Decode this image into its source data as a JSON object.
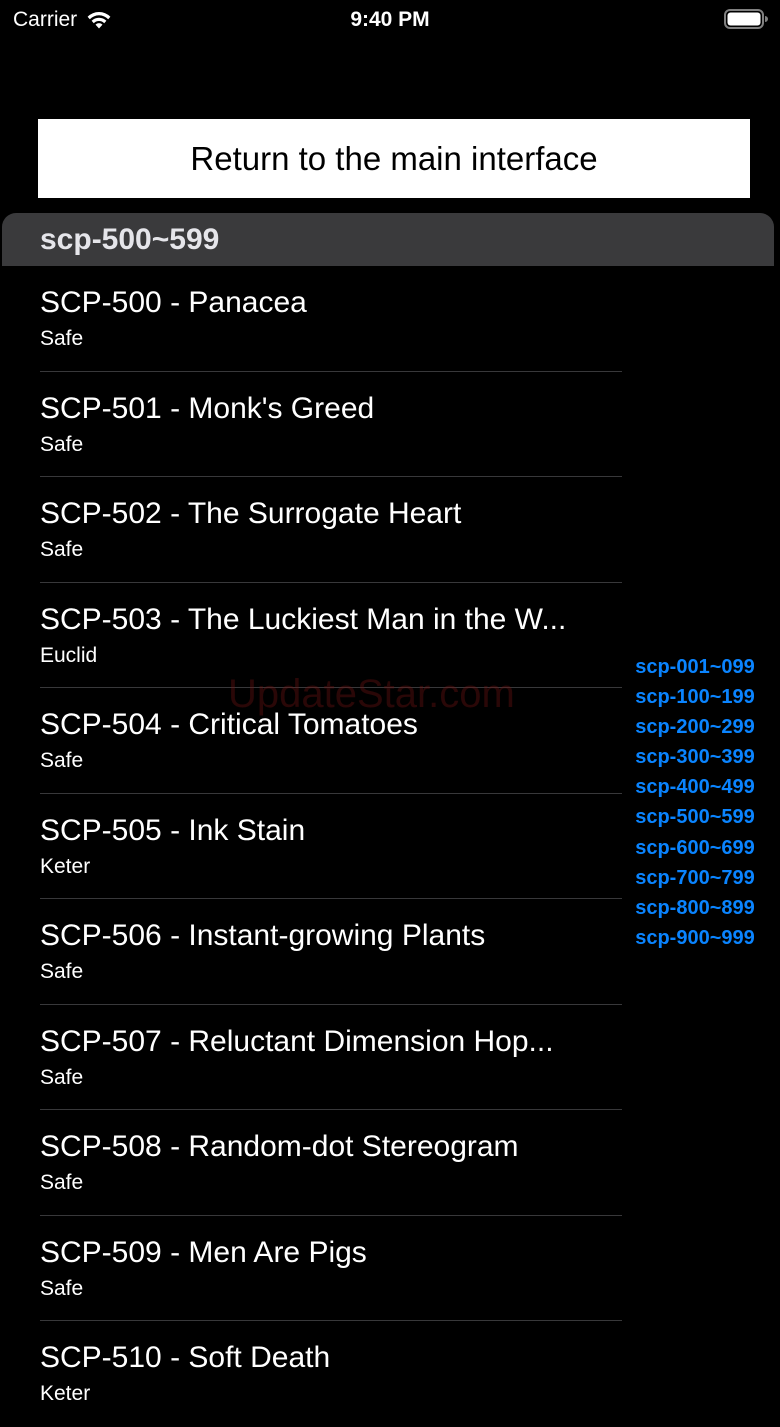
{
  "status_bar": {
    "carrier": "Carrier",
    "time": "9:40 PM"
  },
  "return_button": {
    "label": "Return to the main interface"
  },
  "section": {
    "title": "scp-500~599"
  },
  "items": [
    {
      "title": "SCP-500 - Panacea",
      "subtitle": "Safe"
    },
    {
      "title": "SCP-501 - Monk's Greed",
      "subtitle": "Safe"
    },
    {
      "title": "SCP-502 - The Surrogate Heart",
      "subtitle": "Safe"
    },
    {
      "title": "SCP-503 - The Luckiest Man in the W...",
      "subtitle": "Euclid"
    },
    {
      "title": "SCP-504 - Critical Tomatoes",
      "subtitle": "Safe"
    },
    {
      "title": "SCP-505 - Ink Stain",
      "subtitle": "Keter"
    },
    {
      "title": "SCP-506 - Instant-growing Plants",
      "subtitle": "Safe"
    },
    {
      "title": "SCP-507 - Reluctant Dimension Hop...",
      "subtitle": "Safe"
    },
    {
      "title": "SCP-508 - Random-dot Stereogram",
      "subtitle": "Safe"
    },
    {
      "title": "SCP-509 - Men Are Pigs",
      "subtitle": "Safe"
    },
    {
      "title": "SCP-510 - Soft Death",
      "subtitle": "Keter"
    }
  ],
  "index": [
    "scp-001~099",
    "scp-100~199",
    "scp-200~299",
    "scp-300~399",
    "scp-400~499",
    "scp-500~599",
    "scp-600~699",
    "scp-700~799",
    "scp-800~899",
    "scp-900~999"
  ],
  "watermark": "UpdateStar.com",
  "colors": {
    "background": "#000000",
    "section_header": "#3a3a3c",
    "index_accent": "#0a84ff"
  },
  "icons": {
    "wifi": "wifi-icon",
    "battery": "battery-icon"
  }
}
